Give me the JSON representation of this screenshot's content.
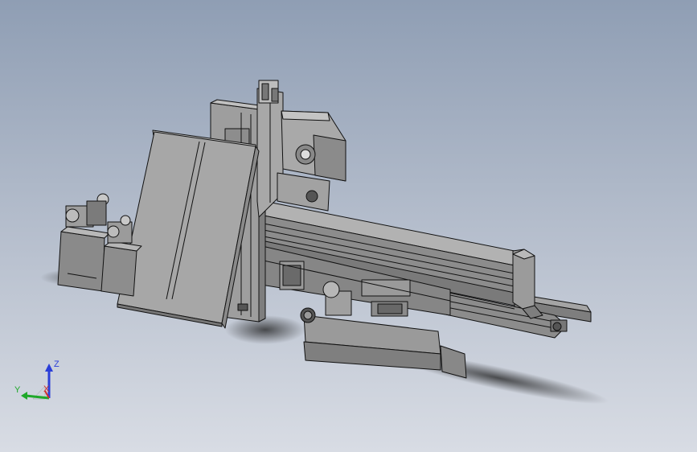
{
  "triad": {
    "x_label": "X",
    "y_label": "Y",
    "z_label": "Z",
    "colors": {
      "x": "#d03030",
      "y": "#1fa82a",
      "z": "#2a3ed8"
    }
  },
  "viewport": {
    "background_top": "#8f9eb4",
    "background_bottom": "#d8dce4",
    "model_fill": "#8a8a8a",
    "model_edge": "#111111"
  }
}
